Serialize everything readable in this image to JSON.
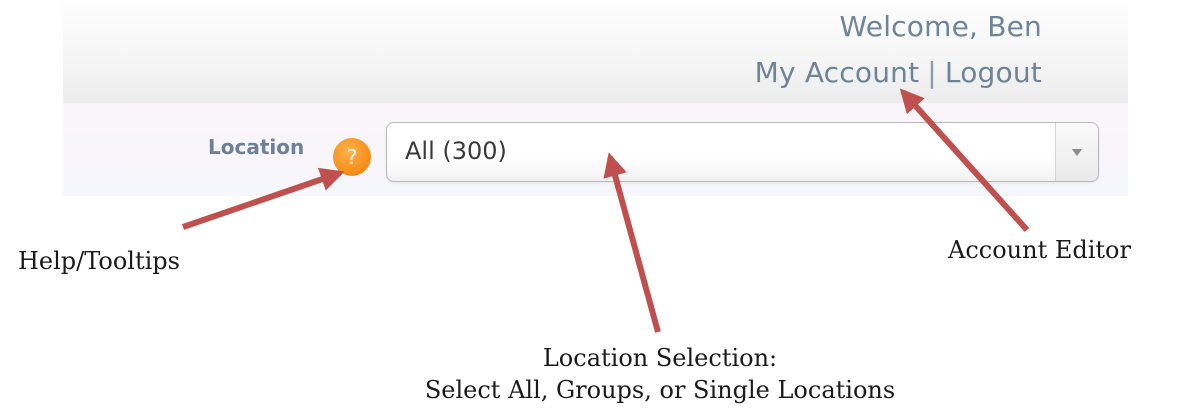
{
  "header": {
    "welcome_text": "Welcome, Ben",
    "my_account_label": "My Account",
    "separator": "|",
    "logout_label": "Logout"
  },
  "filter": {
    "location_label": "Location",
    "help_glyph": "?",
    "location_value": "All (300)"
  },
  "annotations": {
    "help_tooltips": "Help/Tooltips",
    "account_editor": "Account Editor",
    "location_selection_line1": "Location Selection:",
    "location_selection_line2": "Select All, Groups, or Single Locations"
  },
  "colors": {
    "link_text": "#6f8399",
    "help_icon": "#f7901e",
    "arrow": "#c0504d"
  },
  "icons": {
    "help": "help-icon",
    "dropdown": "chevron-down-icon"
  }
}
